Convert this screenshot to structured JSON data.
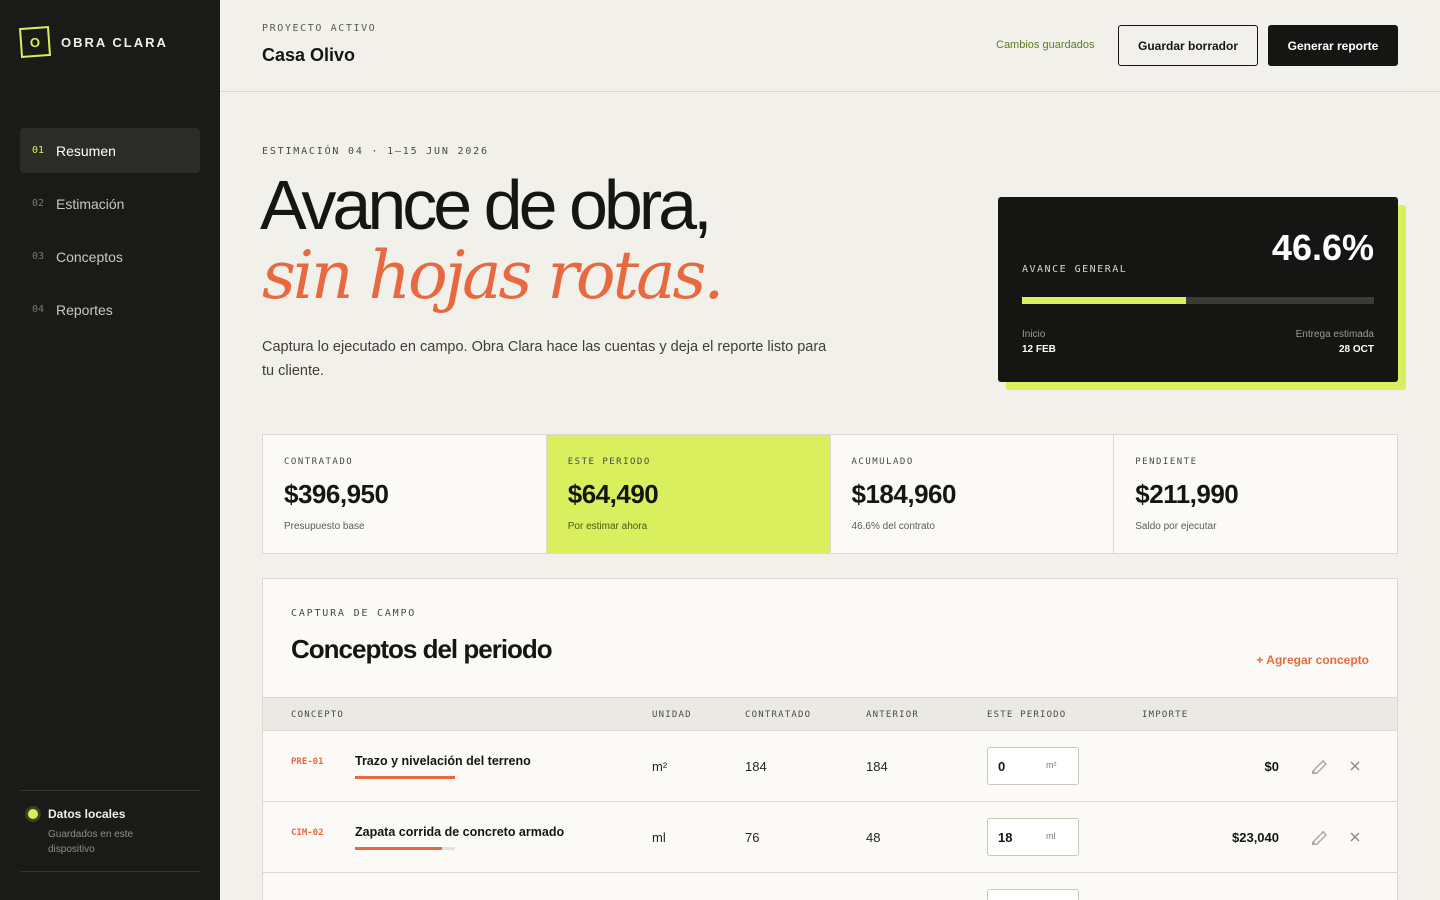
{
  "sidebar": {
    "brand_mark": "O",
    "brand_name": "OBRA CLARA",
    "nav": [
      {
        "num": "01",
        "label": "Resumen",
        "active": true
      },
      {
        "num": "02",
        "label": "Estimación",
        "active": false
      },
      {
        "num": "03",
        "label": "Conceptos",
        "active": false
      },
      {
        "num": "04",
        "label": "Reportes",
        "active": false
      }
    ],
    "footer": {
      "title": "Datos locales",
      "subtitle": "Guardados en este dispositivo"
    }
  },
  "header": {
    "project_label": "PROYECTO ACTIVO",
    "project_name": "Casa Olivo",
    "saved_status": "Cambios guardados",
    "draft_button": "Guardar borrador",
    "report_button": "Generar reporte"
  },
  "hero": {
    "estimate_label": "ESTIMACIÓN 04 · 1–15 JUN 2026",
    "title_line1": "Avance de obra,",
    "title_line2": "sin hojas rotas.",
    "description": "Captura lo ejecutado en campo. Obra Clara hace las cuentas y deja el reporte listo para tu cliente."
  },
  "progress": {
    "label": "AVANCE GENERAL",
    "percent_text": "46.6%",
    "percent_value": 46.6,
    "start_label": "Inicio",
    "start_value": "12 FEB",
    "end_label": "Entrega estimada",
    "end_value": "28 OCT"
  },
  "stats": [
    {
      "label": "CONTRATADO",
      "value": "$396,950",
      "sub": "Presupuesto base"
    },
    {
      "label": "ESTE PERIODO",
      "value": "$64,490",
      "sub": "Por estimar ahora"
    },
    {
      "label": "ACUMULADO",
      "value": "$184,960",
      "sub": "46.6% del contrato"
    },
    {
      "label": "PENDIENTE",
      "value": "$211,990",
      "sub": "Saldo por ejecutar"
    }
  ],
  "concepts": {
    "label": "CAPTURA DE CAMPO",
    "title": "Conceptos del periodo",
    "add_button": "+ Agregar concepto",
    "columns": {
      "concept": "CONCEPTO",
      "unit": "UNIDAD",
      "contracted": "CONTRATADO",
      "previous": "ANTERIOR",
      "period": "ESTE PERIODO",
      "amount": "IMPORTE"
    },
    "rows": [
      {
        "code": "PRE-01",
        "name": "Trazo y nivelación del terreno",
        "progress": 1.0,
        "unit": "m²",
        "contracted": "184",
        "previous": "184",
        "period": "0",
        "amount": "$0"
      },
      {
        "code": "CIM-02",
        "name": "Zapata corrida de concreto armado",
        "progress": 0.87,
        "unit": "ml",
        "contracted": "76",
        "previous": "48",
        "period": "18",
        "amount": "$23,040"
      }
    ]
  }
}
